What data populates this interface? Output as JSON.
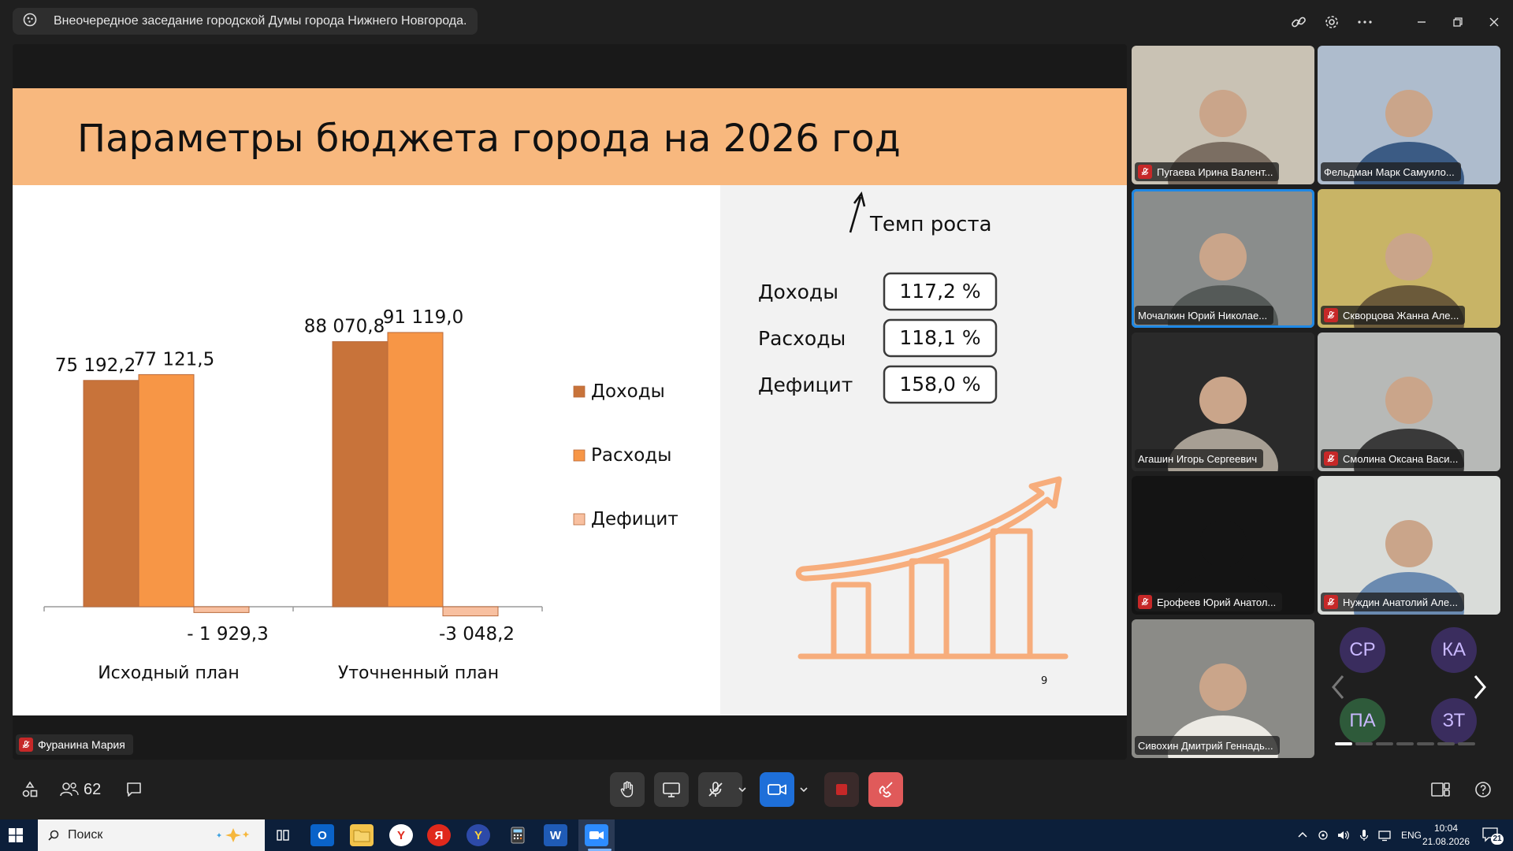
{
  "window": {
    "title": "Внеочередное заседание городской Думы города Нижнего Новгорода."
  },
  "slide": {
    "title": "Параметры бюджета города на 2026 год",
    "page_number": "9",
    "growth_title": "Темп роста",
    "growth": [
      {
        "label": "Доходы",
        "value": "117,2 %"
      },
      {
        "label": "Расходы",
        "value": "118,1 %"
      },
      {
        "label": "Дефицит",
        "value": "158,0 %"
      }
    ]
  },
  "chart_data": {
    "type": "bar",
    "categories": [
      "Исходный план",
      "Уточненный план"
    ],
    "series": [
      {
        "name": "Доходы",
        "values": [
          75192.2,
          88070.8
        ],
        "labels": [
          "75 192,2",
          "88 070,8"
        ],
        "color": "#c8733a"
      },
      {
        "name": "Расходы",
        "values": [
          77121.5,
          91119.0
        ],
        "labels": [
          "77 121,5",
          "91 119,0"
        ],
        "color": "#f79646"
      },
      {
        "name": "Дефицит",
        "values": [
          -1929.3,
          -3048.2
        ],
        "labels": [
          "- 1 929,3",
          "-3 048,2"
        ],
        "color": "#f8c0a0"
      }
    ],
    "legend_position": "right"
  },
  "speaker": {
    "name": "Фуранина Мария"
  },
  "participants": [
    {
      "name": "Пугаева Ирина Валент...",
      "muted": true,
      "active": false
    },
    {
      "name": "Фельдман Марк Самуило...",
      "muted": false,
      "active": false
    },
    {
      "name": "Мочалкин Юрий Николае...",
      "muted": false,
      "active": true
    },
    {
      "name": "Скворцова Жанна Але...",
      "muted": true,
      "active": false
    },
    {
      "name": "Агашин Игорь Сергеевич",
      "muted": false,
      "active": false
    },
    {
      "name": "Смолина Оксана Васи...",
      "muted": true,
      "active": false
    },
    {
      "name": "Ерофеев Юрий Анатол...",
      "muted": true,
      "active": false
    },
    {
      "name": "Нуждин Анатолий Але...",
      "muted": true,
      "active": false
    },
    {
      "name": "Сивохин Дмитрий Геннадь...",
      "muted": false,
      "active": false
    }
  ],
  "avatars": [
    "СР",
    "КА",
    "ПА",
    "ЗТ"
  ],
  "toolbar": {
    "participant_count": "62"
  },
  "taskbar": {
    "search_placeholder": "Поиск",
    "lang": "ENG",
    "time": "10:04",
    "date": "21.08.2026",
    "notifications": "21"
  },
  "colors": {
    "accent": "#1e88e5",
    "slide_header": "#f8b87e",
    "leave": "#e05a5a",
    "mute": "#c62828"
  }
}
